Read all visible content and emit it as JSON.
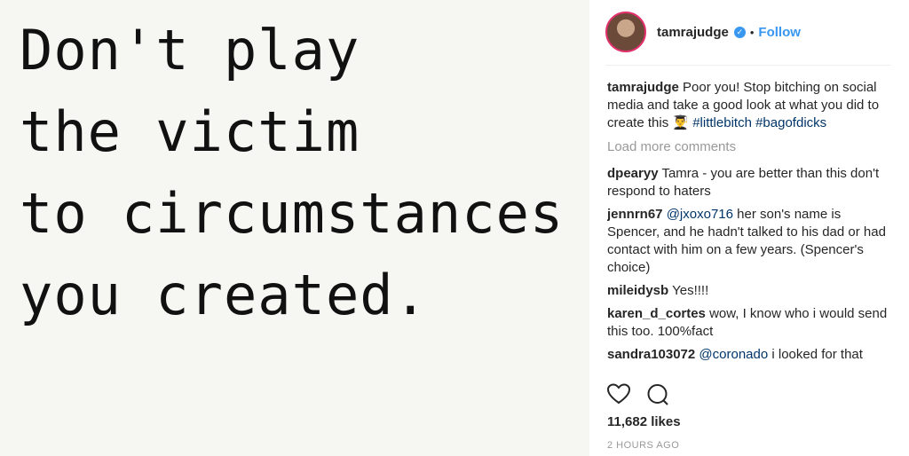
{
  "post": {
    "quote_lines": [
      "Don't play",
      "the victim",
      "to circumstances",
      "you created."
    ]
  },
  "header": {
    "username": "tamrajudge",
    "separator": "•",
    "follow_label": "Follow"
  },
  "caption": {
    "username": "tamrajudge",
    "text": "Poor you! Stop bitching on social media and take a good look at what you did to create this 👨‍🎓",
    "hashtag1": "#littlebitch",
    "hashtag2": "#bagofdicks"
  },
  "load_more": "Load more comments",
  "comments": [
    {
      "user": "dpearyy",
      "text": "Tamra - you are better than this don't respond to haters"
    },
    {
      "user": "jennrn67",
      "mention": "@jxoxo716",
      "text": "her son's name is Spencer, and he hadn't talked to his dad or had contact with him on a few years. (Spencer's choice)"
    },
    {
      "user": "mileidysb",
      "text": "Yes!!!!"
    },
    {
      "user": "karen_d_cortes",
      "text": "wow, I know who i would send this too. 100%fact"
    },
    {
      "user": "sandra103072",
      "mention": "@coronado",
      "text": "i looked for that"
    }
  ],
  "likes": "11,682 likes",
  "timestamp": "2 HOURS AGO",
  "icons": {
    "like": "heart-icon",
    "comment": "comment-icon",
    "verified": "verified-badge-icon"
  },
  "colors": {
    "link": "#3897f0",
    "hashtag": "#003569",
    "muted": "#999999"
  }
}
